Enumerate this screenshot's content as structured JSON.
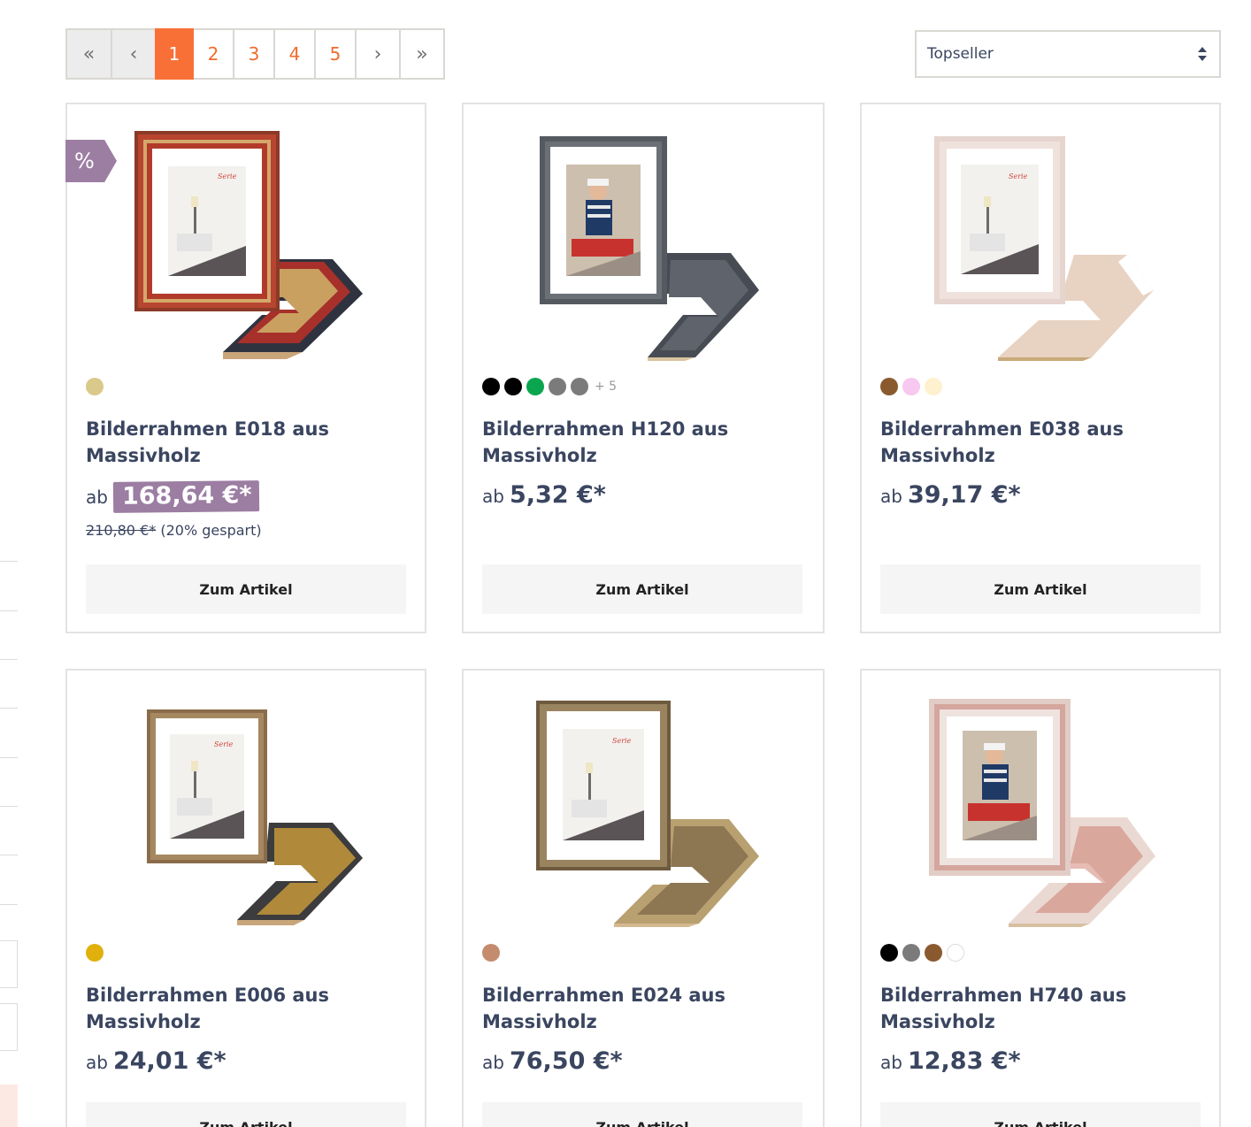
{
  "pagination": {
    "first": "«",
    "prev": "‹",
    "pages": [
      "1",
      "2",
      "3",
      "4",
      "5"
    ],
    "active_page": "1",
    "next": "›",
    "last": "»"
  },
  "sort": {
    "selected": "Topseller"
  },
  "products": [
    {
      "title": "Bilderrahmen E018 aus Massivholz",
      "price_prefix": "ab",
      "price": "168,64 €*",
      "old_price": "210,80 €*",
      "savings": "(20% gespart)",
      "sale_badge": "%",
      "swatches": [
        "#d9c98a"
      ],
      "more_colors": "",
      "cta": "Zum Artikel",
      "image": "frame-red-gold-icon"
    },
    {
      "title": "Bilderrahmen H120 aus Massivholz",
      "price_prefix": "ab",
      "price": "5,32 €*",
      "swatches": [
        "#000000",
        "#000000",
        "#0aa64f",
        "#7b7b7b",
        "#7b7b7b"
      ],
      "more_colors": "+ 5",
      "cta": "Zum Artikel",
      "image": "frame-grey-icon"
    },
    {
      "title": "Bilderrahmen E038 aus Massivholz",
      "price_prefix": "ab",
      "price": "39,17 €*",
      "swatches": [
        "#8a5a2e",
        "#f7c8f0",
        "#fdf1cf"
      ],
      "more_colors": "",
      "cta": "Zum Artikel",
      "image": "frame-pink-white-icon"
    },
    {
      "title": "Bilderrahmen E006 aus Massivholz",
      "price_prefix": "ab",
      "price": "24,01 €*",
      "swatches": [
        "#e0b10c"
      ],
      "more_colors": "",
      "cta": "Zum Artikel",
      "image": "frame-gold-ornate-icon"
    },
    {
      "title": "Bilderrahmen E024 aus Massivholz",
      "price_prefix": "ab",
      "price": "76,50 €*",
      "swatches": [
        "#c48b6e"
      ],
      "more_colors": "",
      "cta": "Zum Artikel",
      "image": "frame-bronze-ornate-icon"
    },
    {
      "title": "Bilderrahmen H740 aus Massivholz",
      "price_prefix": "ab",
      "price": "12,83 €*",
      "swatches": [
        "#000000",
        "#7b7b7b",
        "#8a5a2e",
        "#ffffff"
      ],
      "more_colors": "",
      "cta": "Zum Artikel",
      "image": "frame-shabby-white-icon"
    }
  ],
  "colors": {
    "accent_orange": "#f97037",
    "sale_purple": "#9c7ea2",
    "text_dark": "#3a4560"
  }
}
